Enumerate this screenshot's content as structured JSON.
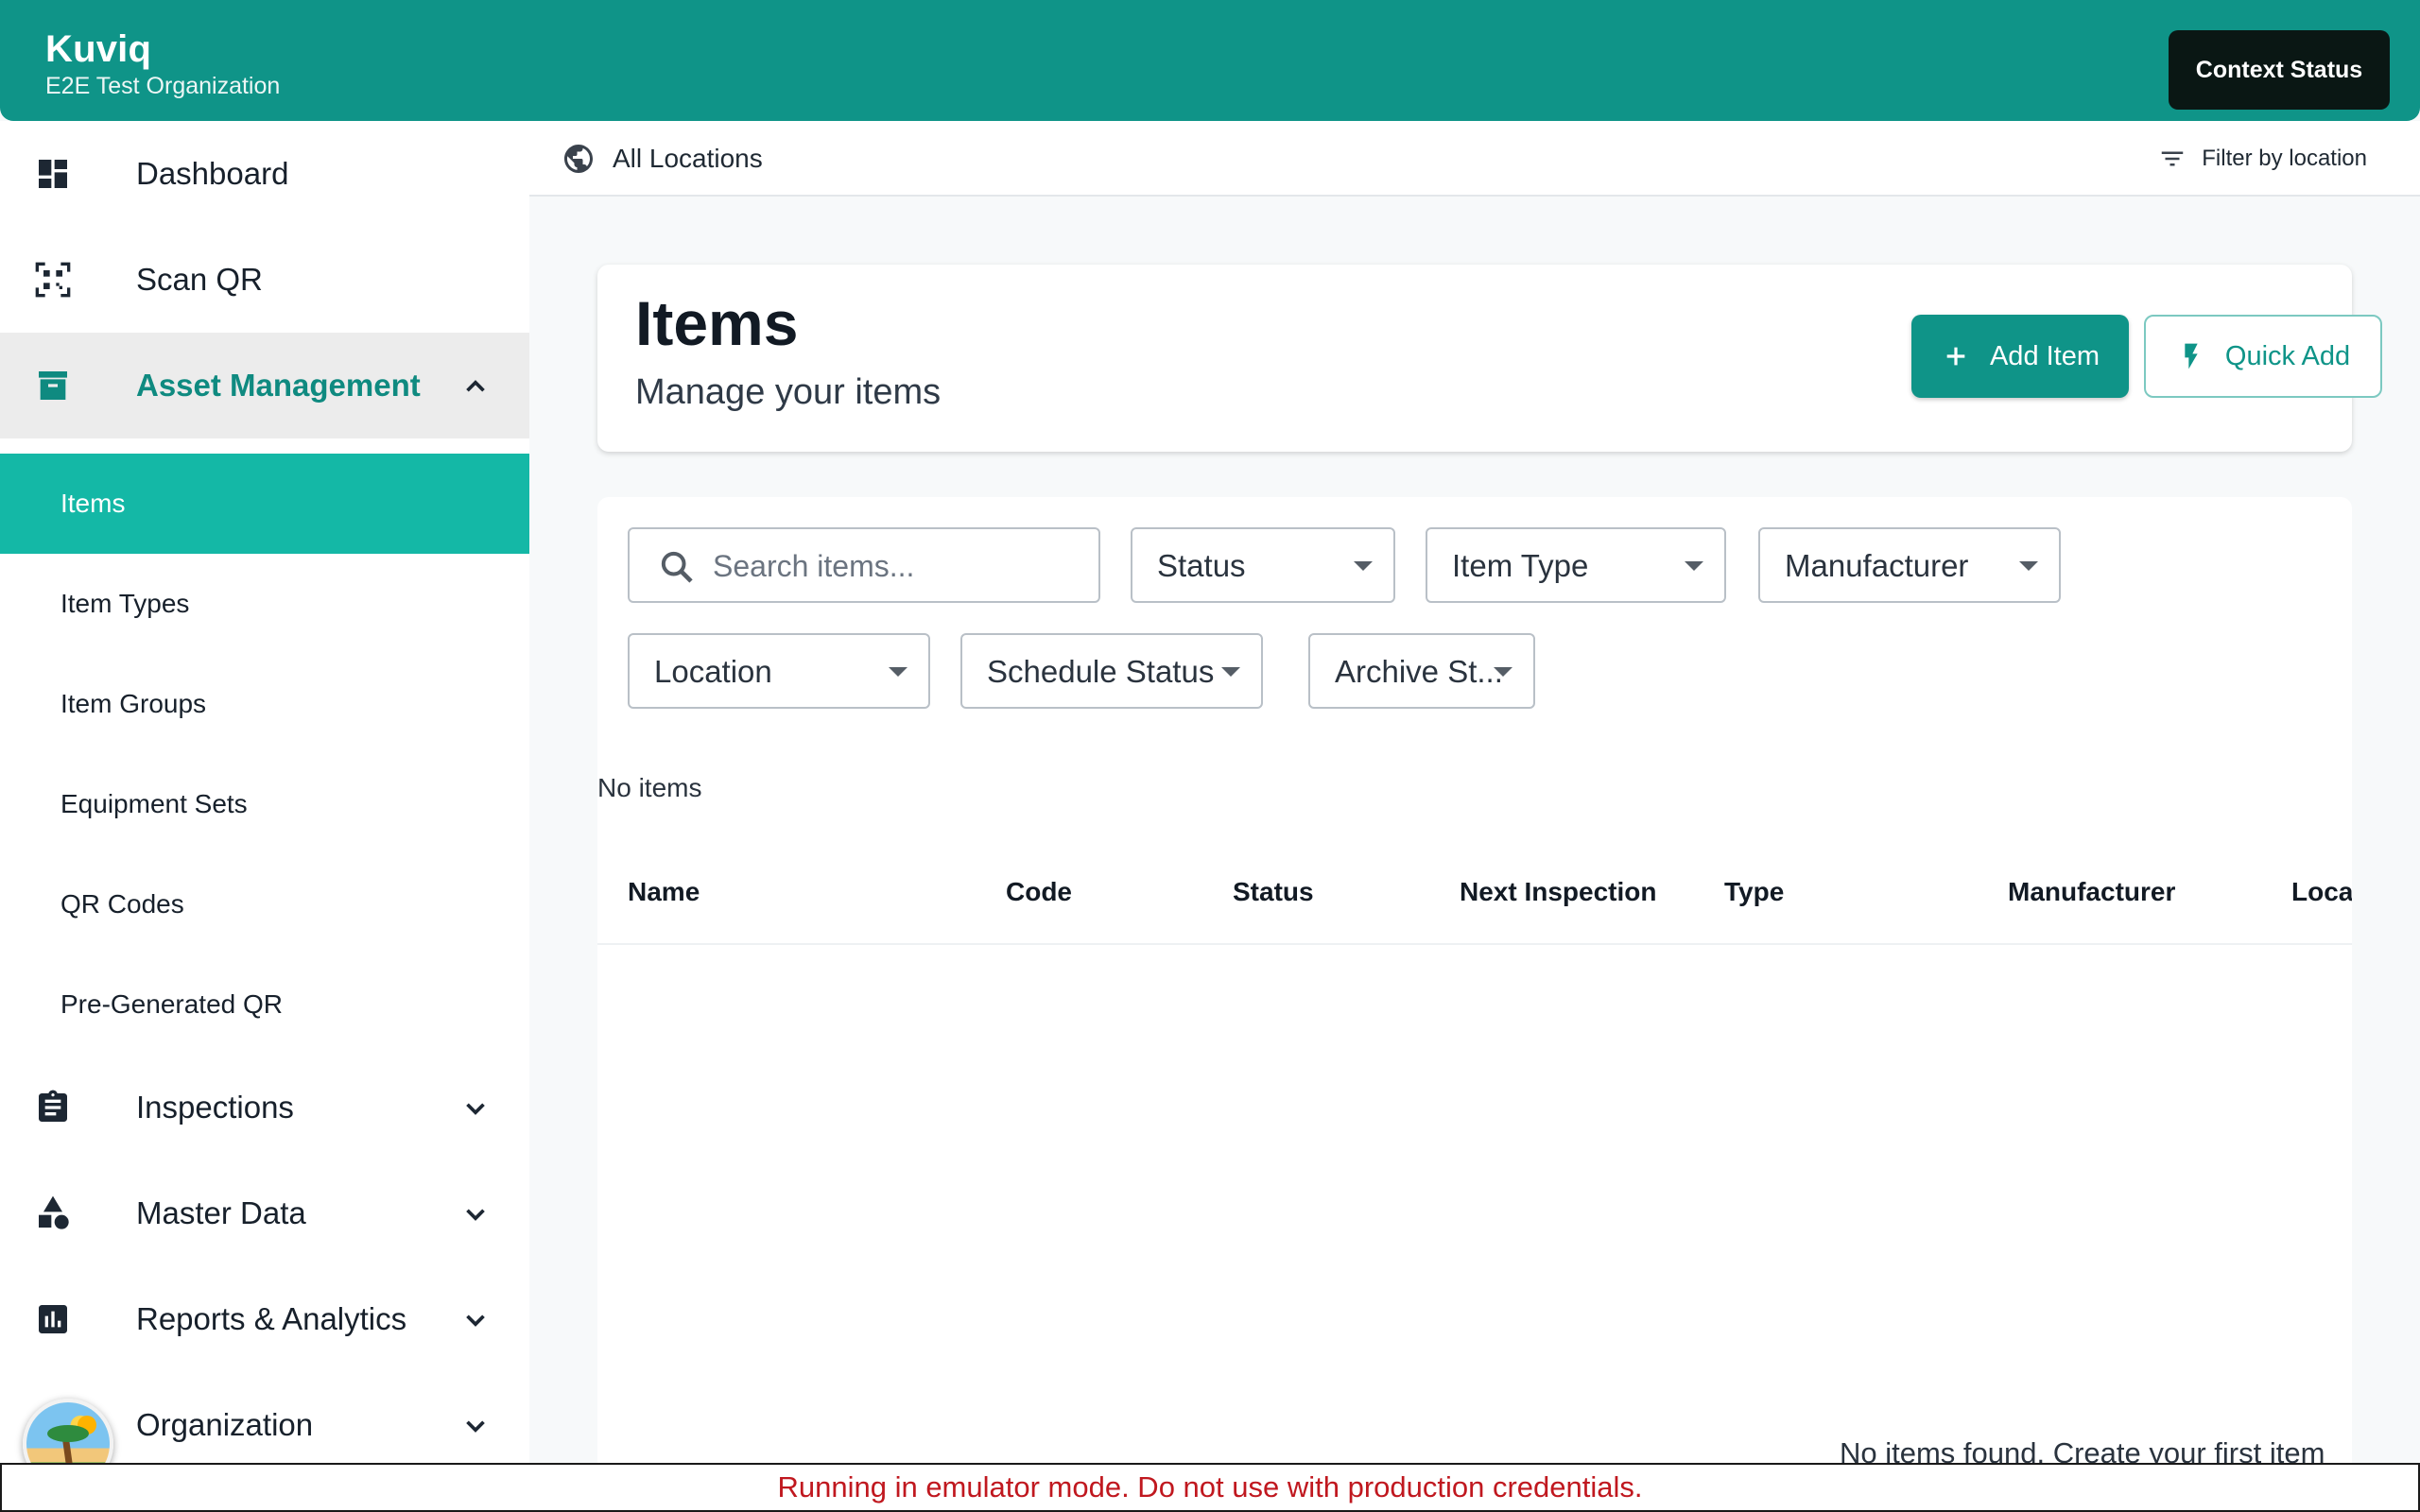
{
  "header": {
    "brand": "Kuviq",
    "organization": "E2E Test Organization",
    "context_button": "Context Status"
  },
  "sidebar": {
    "items": [
      {
        "label": "Dashboard",
        "icon": "dashboard-icon"
      },
      {
        "label": "Scan QR",
        "icon": "qr-scan-icon"
      },
      {
        "label": "Asset Management",
        "icon": "archive-box-icon",
        "expanded": true
      },
      {
        "label": "Inspections",
        "icon": "clipboard-icon"
      },
      {
        "label": "Master Data",
        "icon": "shapes-icon"
      },
      {
        "label": "Reports & Analytics",
        "icon": "bar-chart-icon"
      },
      {
        "label": "Organization",
        "icon": "organization-icon"
      }
    ],
    "sub_items": [
      {
        "label": "Items",
        "active": true
      },
      {
        "label": "Item Types"
      },
      {
        "label": "Item Groups"
      },
      {
        "label": "Equipment Sets"
      },
      {
        "label": "QR Codes"
      },
      {
        "label": "Pre-Generated QR"
      }
    ]
  },
  "location_bar": {
    "label": "All Locations",
    "filter_label": "Filter by location"
  },
  "page": {
    "title": "Items",
    "subtitle": "Manage your items",
    "add_button": "Add Item",
    "quick_add_button": "Quick Add"
  },
  "filters": {
    "search_placeholder": "Search items...",
    "status": "Status",
    "item_type": "Item Type",
    "manufacturer": "Manufacturer",
    "location": "Location",
    "schedule_status": "Schedule Status",
    "archive_status": "Archive St..."
  },
  "results": {
    "count_text": "No items",
    "empty_message": "No items found. Create your first item"
  },
  "table": {
    "columns": [
      "Name",
      "Code",
      "Status",
      "Next Inspection",
      "Type",
      "Manufacturer",
      "Loca"
    ]
  },
  "banner": {
    "text": "Running in emulator mode. Do not use with production credentials."
  },
  "colors": {
    "primary": "#0f9488",
    "active_nav": "#14b8a6",
    "banner_text": "#c0181f"
  }
}
